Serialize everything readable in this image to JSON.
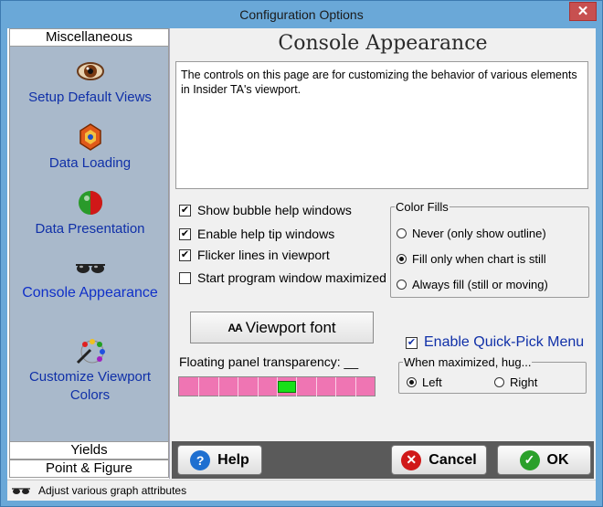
{
  "window": {
    "title": "Configuration Options",
    "close_glyph": "✕"
  },
  "sidebar": {
    "header_top": "Miscellaneous",
    "items": [
      {
        "label": "Setup Default Views",
        "icon": "eye-icon"
      },
      {
        "label": "Data Loading",
        "icon": "data-loading-icon"
      },
      {
        "label": "Data Presentation",
        "icon": "red-ball-icon"
      },
      {
        "label": "Console Appearance",
        "icon": "sunglasses-icon",
        "selected": true
      },
      {
        "label": "Customize Viewport Colors",
        "icon": "palette-icon"
      }
    ],
    "header_yields": "Yields",
    "header_point": "Point & Figure"
  },
  "main": {
    "heading": "Console Appearance",
    "description": "The controls on this page are for customizing the behavior of various elements in Insider TA's viewport.",
    "checkboxes": [
      {
        "label": "Show bubble help windows",
        "checked": true
      },
      {
        "label": "Enable help tip windows",
        "checked": true
      },
      {
        "label": "Flicker lines in viewport",
        "checked": true
      },
      {
        "label": "Start program window maximized",
        "checked": false
      }
    ],
    "color_fills": {
      "legend": "Color Fills",
      "options": [
        {
          "label": "Never (only show outline)",
          "selected": false
        },
        {
          "label": "Fill only when chart is still",
          "selected": true
        },
        {
          "label": "Always fill (still or moving)",
          "selected": false
        }
      ]
    },
    "viewport_font_button": "Viewport font",
    "viewport_font_glyph": "AA",
    "quick_pick": {
      "label": "Enable Quick-Pick Menu",
      "checked": true
    },
    "hug": {
      "legend": "When maximized, hug...",
      "options": [
        {
          "label": "Left",
          "selected": true
        },
        {
          "label": "Right",
          "selected": false
        }
      ]
    },
    "transparency": {
      "label": "Floating panel transparency: __",
      "level": 0.55
    }
  },
  "buttons": {
    "help": "Help",
    "cancel": "Cancel",
    "ok": "OK"
  },
  "status": {
    "text": "Adjust various graph attributes"
  },
  "colors": {
    "accent": "#1030a8",
    "slider_fill": "#ef75b3",
    "slider_thumb": "#18e018"
  }
}
